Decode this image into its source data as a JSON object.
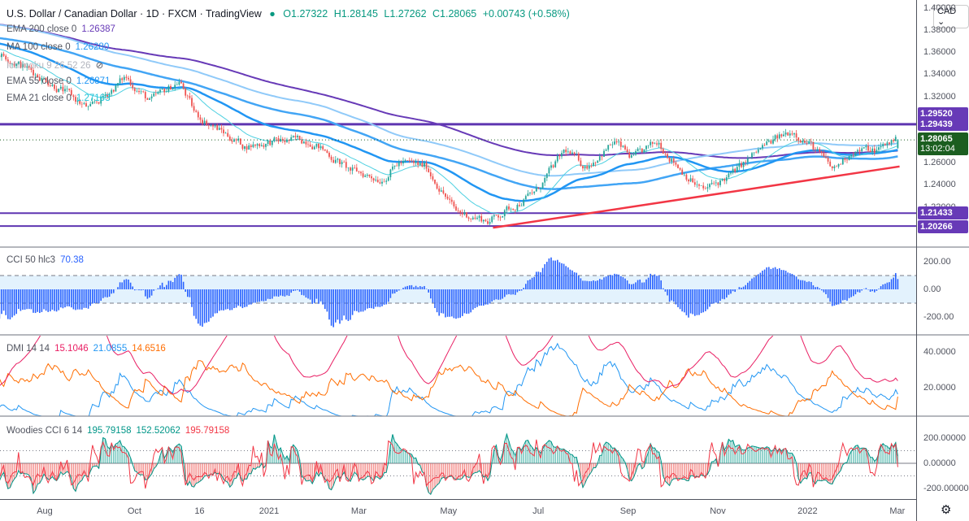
{
  "header": {
    "title": "U.S. Dollar / Canadian Dollar · 1D · FXCM · TradingView",
    "open": "O1.27322",
    "high": "H1.28145",
    "low": "L1.27262",
    "close": "C1.28065",
    "change": "+0.00743 (+0.58%)"
  },
  "legend": {
    "ema200": {
      "label": "EMA 200 close 0",
      "value": "1.26387"
    },
    "ma100": {
      "label": "MA 100 close 0",
      "value": "1.26280"
    },
    "ichimoku": {
      "label": "Ichimoku 9 26 52 26"
    },
    "ema55": {
      "label": "EMA 55 close 0",
      "value": "1.26871"
    },
    "ema21": {
      "label": "EMA 21 close 0",
      "value": "1.27163"
    },
    "cci": {
      "label": "CCI 50 hlc3",
      "value": "70.38"
    },
    "dmi": {
      "label": "DMI 14 14",
      "v1": "15.1046",
      "v2": "21.0855",
      "v3": "14.6516"
    },
    "woodies": {
      "label": "Woodies CCI 6 14",
      "v1": "195.79158",
      "v2": "152.52062",
      "v3": "195.79158"
    }
  },
  "currency_button": "CAD",
  "colors": {
    "up": "#26a69a",
    "down": "#ef5350",
    "ema21": "#4dd0e1",
    "ema55": "#2196f3",
    "ma100": "#42a5f5",
    "ema200": "#673ab7",
    "levels": "#5e35b1",
    "trend": "#f23645"
  },
  "price_axis": {
    "ticks": [
      "1.38000",
      "1.36000",
      "1.34000",
      "1.32000",
      "1.26000",
      "1.24000",
      "1.22000"
    ],
    "top_tick": "1.40000"
  },
  "price_tags": [
    {
      "value": "1.29520"
    },
    {
      "value": "1.29439"
    },
    {
      "value": "1.21433"
    },
    {
      "value": "1.20266"
    }
  ],
  "last_price": {
    "value": "1.28065",
    "countdown": "13:02:04"
  },
  "cci_axis": [
    "200.00",
    "0.00",
    "-200.00"
  ],
  "dmi_axis": [
    "40.0000",
    "20.0000"
  ],
  "woodies_axis": [
    "200.00000",
    "0.00000",
    "-200.00000"
  ],
  "time_axis": [
    {
      "label": "Aug",
      "t": 0
    },
    {
      "label": "Oct",
      "t": 2
    },
    {
      "label": "16",
      "t": 3.45
    },
    {
      "label": "2021",
      "t": 5
    },
    {
      "label": "Mar",
      "t": 7
    },
    {
      "label": "May",
      "t": 9
    },
    {
      "label": "Jul",
      "t": 11
    },
    {
      "label": "Sep",
      "t": 13
    },
    {
      "label": "Nov",
      "t": 15
    },
    {
      "label": "2022",
      "t": 17
    },
    {
      "label": "Mar",
      "t": 19
    }
  ],
  "chart_data": {
    "type": "candlestick",
    "symbol": "USDCAD",
    "interval": "1D",
    "t_unit": "months since 2020-08-01",
    "close_path": [
      [
        -12,
        1.41
      ],
      [
        -6,
        1.38
      ],
      [
        -2,
        1.37
      ],
      [
        -1,
        1.3594
      ],
      [
        0.1,
        1.3337
      ],
      [
        1,
        1.308
      ],
      [
        1.8,
        1.3374
      ],
      [
        2.35,
        1.315
      ],
      [
        3,
        1.334
      ],
      [
        3.35,
        1.304
      ],
      [
        4.45,
        1.275
      ],
      [
        5,
        1.2785
      ],
      [
        5.9,
        1.281
      ],
      [
        6.8,
        1.253
      ],
      [
        7.5,
        1.2454
      ],
      [
        7.9,
        1.26
      ],
      [
        8.5,
        1.2565
      ],
      [
        9.15,
        1.216
      ],
      [
        9.9,
        1.2072
      ],
      [
        10.4,
        1.2197
      ],
      [
        10.96,
        1.2344
      ],
      [
        11.6,
        1.2712
      ],
      [
        12.05,
        1.2565
      ],
      [
        12.7,
        1.2785
      ],
      [
        13.1,
        1.2638
      ],
      [
        13.68,
        1.2785
      ],
      [
        14.2,
        1.253
      ],
      [
        14.67,
        1.2344
      ],
      [
        15.3,
        1.2491
      ],
      [
        16.03,
        1.2749
      ],
      [
        16.67,
        1.2896
      ],
      [
        17.1,
        1.2749
      ],
      [
        17.57,
        1.253
      ],
      [
        18.0,
        1.2712
      ],
      [
        18.55,
        1.2712
      ],
      [
        18.9,
        1.2806
      ]
    ],
    "last_bar": {
      "open": 1.27322,
      "high": 1.28145,
      "low": 1.27262,
      "close": 1.28065
    },
    "horizontal_levels": [
      1.2952,
      1.29439,
      1.21433,
      1.20266
    ],
    "trendline": [
      [
        9.99,
        1.2012
      ],
      [
        19.05,
        1.2566
      ]
    ],
    "price_range": [
      1.2,
      1.4
    ]
  }
}
